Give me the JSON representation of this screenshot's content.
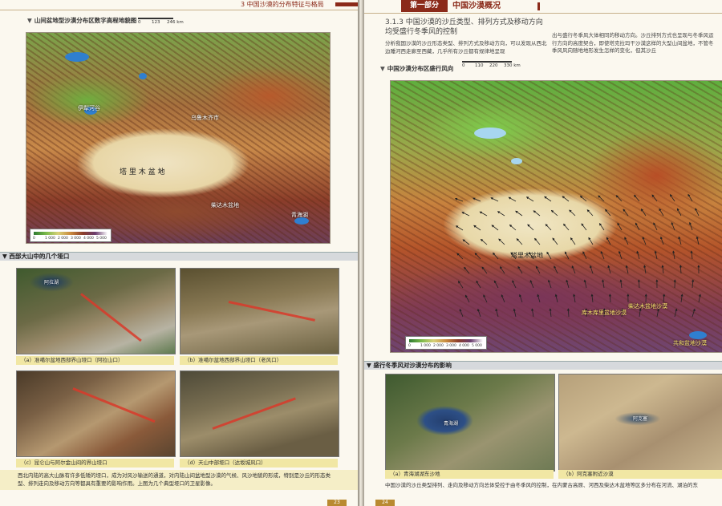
{
  "left_page": {
    "running_head": "3  中国沙漠的分布特征与格局",
    "map1": {
      "title": "山间盆地型沙漠分布区数字高程地貌图",
      "scale": [
        "0",
        "123",
        "246 km"
      ],
      "labels": {
        "yili": "伊犁河谷",
        "urumqi": "乌鲁木齐市",
        "taklimakan": "塔 里 木 盆 地",
        "qinghai": "青海湖",
        "qaidam": "柴达木盆地"
      },
      "legend_ticks": [
        "0",
        "1 000",
        "2 000",
        "3 000",
        "4 000",
        "5 000"
      ]
    },
    "section_title": "西部大山中的几个垭口",
    "photos": [
      {
        "caption": "（a）准噶尔盆地西部界山垭口（阿拉山口）",
        "label": "阿拉湖"
      },
      {
        "caption": "（b）准噶尔盆地西部界山垭口（老风口）",
        "label": ""
      },
      {
        "caption": "（c）昆仑山与阿尔金山间的界山垭口",
        "label": ""
      },
      {
        "caption": "（d）天山中部垭口（达坂城风口）",
        "label": ""
      }
    ],
    "body_text": "西北内陆的高大山脉有许多低矮的垭口，成为对风沙输送的通道，对内陆山间盆地型沙漠的气候、风沙地貌的形成，特别是沙丘的形态类型、排列走向及移动方向等都具有重要的影响作用。上图为几个典型垭口的卫星影像。",
    "page_number": "23"
  },
  "right_page": {
    "part_label": "第一部分",
    "chapter": "中国沙漠概况",
    "heading": "3.1.3 中国沙漠的沙丘类型、排列方式及移动方向均受盛行冬季风的控制",
    "para1": "分析我国沙漠的沙丘形态类型、排列方式及移动方向，可以发现从西北边陲河西走廊至西藏，几乎所有沙丘都有规律地呈现",
    "para2": "出与盛行冬季风大体相同的移动方向。沙丘排列方式也呈现与冬季风运行方向的高度契合，即使塔克拉玛干沙漠这样的大型山间盆地，不管冬季风风向随地地形发生怎样的变化，但其沙丘",
    "map2": {
      "title": "中国沙漠分布区盛行风向",
      "scale": [
        "0",
        "110",
        "220",
        "330 km"
      ],
      "labels": {
        "taklimakan": "塔里木盆地",
        "kumtag": "库木库里盆地沙漠",
        "qaidam": "柴达木盆地沙漠",
        "gonghe": "共和盆地沙漠"
      },
      "legend_ticks": [
        "0",
        "1 000",
        "2 000",
        "3 000",
        "4 000",
        "5 000"
      ]
    },
    "section_title": "盛行冬季风对沙漠分布的影响",
    "photos": [
      {
        "caption": "（a）青海湖湖东沙地",
        "label": "青海湖"
      },
      {
        "caption": "（b）阿克塞附近沙漠",
        "label": "阿克塞"
      }
    ],
    "body_text": "中国沙漠的沙丘类型排列、走向及移动方向总体受控于由冬季风的控制，在内蒙古高原、河西及柴达木盆地等区多分布在河流、湖泊的东",
    "page_number": "24"
  }
}
